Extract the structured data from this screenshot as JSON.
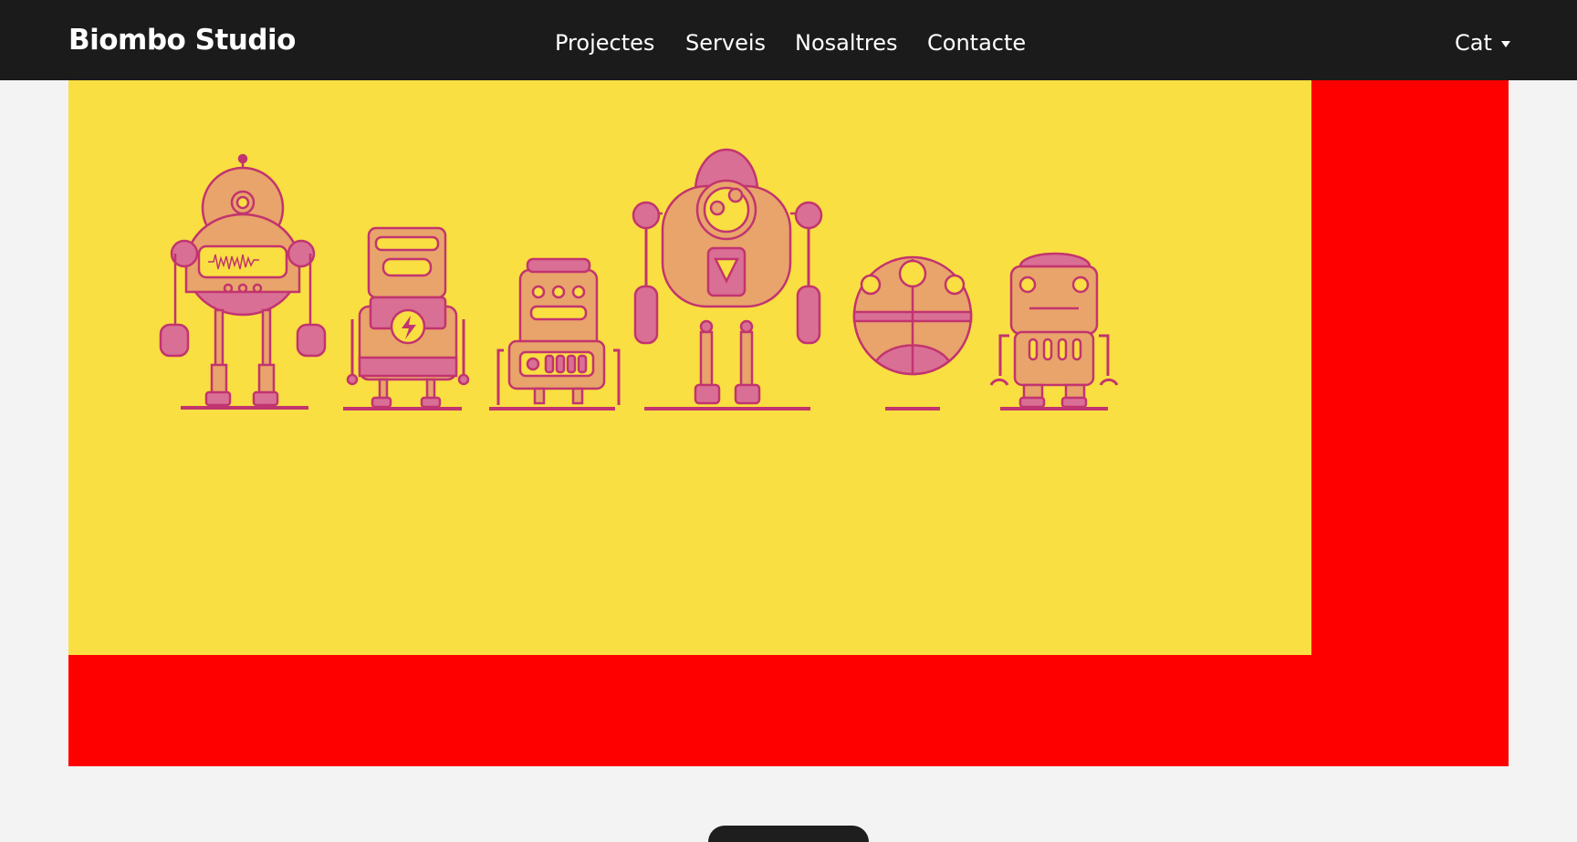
{
  "header": {
    "brand": "Biombo Studio",
    "nav": [
      {
        "label": "Projectes"
      },
      {
        "label": "Serveis"
      },
      {
        "label": "Nosaltres"
      },
      {
        "label": "Contacte"
      }
    ],
    "language": {
      "label": "Cat",
      "icon": "caret-down-icon"
    }
  },
  "hero": {
    "image": "robots-illustration",
    "colors": {
      "yellow": "#f9df41",
      "red": "#ff0000",
      "robot_fill": "#e8a46a",
      "robot_pink": "#d96f95",
      "robot_line": "#c2346f"
    },
    "robots": [
      "radio-robot",
      "battery-robot",
      "box-robot",
      "tall-robot",
      "ball-robot",
      "small-robot"
    ]
  },
  "toolbar": {
    "icon": "floating-toolbar"
  }
}
